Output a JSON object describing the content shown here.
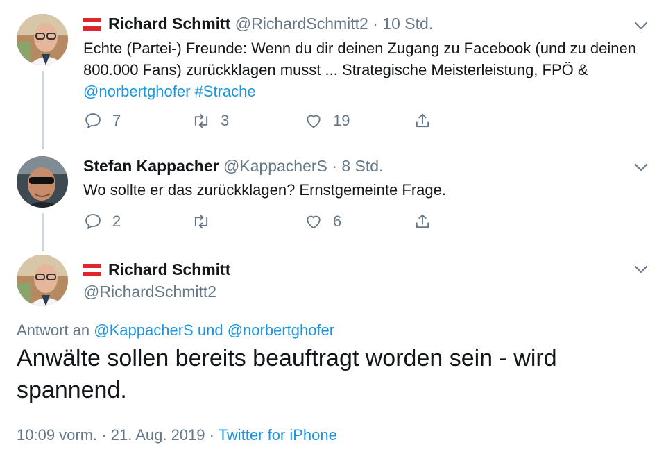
{
  "tweets": [
    {
      "name": "Richard Schmitt",
      "handle": "@RichardSchmitt2",
      "separator": "·",
      "time": "10 Std.",
      "text_plain": "Echte (Partei-) Freunde: Wenn du dir deinen Zugang zu Facebook (und zu deinen 800.000 Fans) zurückklagen musst ... Strategische Meisterleistung, FPÖ & ",
      "mention": "@norbertghofer",
      "hashtag": "#Strache",
      "reply_count": "7",
      "retweet_count": "3",
      "like_count": "19"
    },
    {
      "name": "Stefan Kappacher",
      "handle": "@KappacherS",
      "separator": "·",
      "time": "8 Std.",
      "text": "Wo sollte er das zurückklagen? Ernstgemeinte Frage.",
      "reply_count": "2",
      "retweet_count": "",
      "like_count": "6"
    },
    {
      "name": "Richard Schmitt",
      "handle": "@RichardSchmitt2",
      "reply_to_prefix": "Antwort an",
      "reply_to_user1": "@KappacherS",
      "reply_to_and": "und",
      "reply_to_user2": "@norbertghofer",
      "text": "Anwälte sollen bereits beauftragt worden sein - wird spannend.",
      "timestamp": "10:09 vorm. · 21. Aug. 2019",
      "meta_separator": "·",
      "source": "Twitter for iPhone"
    }
  ],
  "colors": {
    "link": "#1b95e0",
    "muted": "#657786",
    "flag_red": "#e0242c",
    "thread_line": "#ccd6dd"
  },
  "icons": {
    "reply": "speech-bubble-icon",
    "retweet": "retweet-icon",
    "like": "heart-icon",
    "share": "share-icon",
    "more": "chevron-down-icon",
    "flag": "austria-flag-icon"
  }
}
